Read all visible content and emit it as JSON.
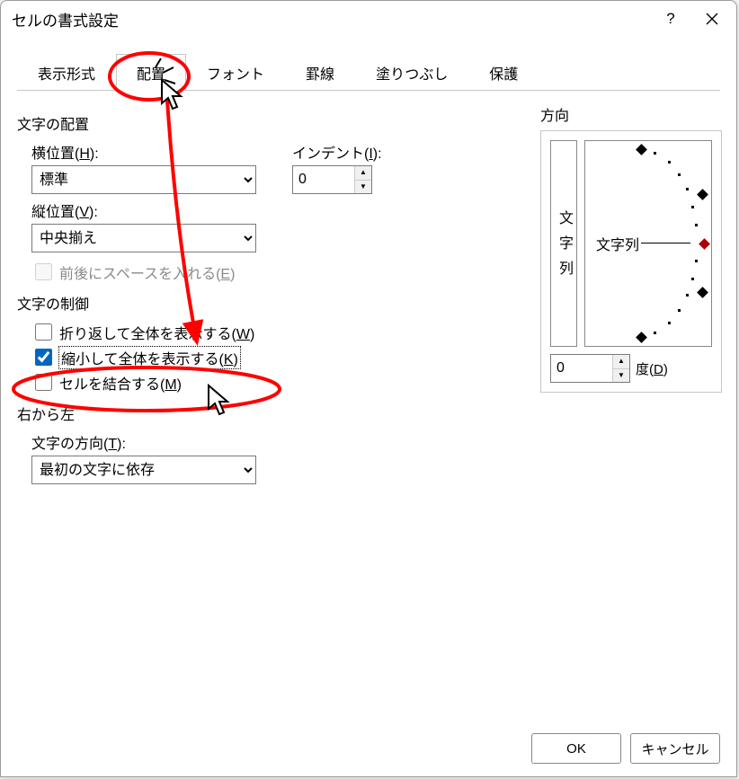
{
  "title": "セルの書式設定",
  "tabs": {
    "t0": "表示形式",
    "t1": "配置",
    "t2": "フォント",
    "t3": "罫線",
    "t4": "塗りつぶし",
    "t5": "保護"
  },
  "text_alignment": {
    "group": "文字の配置",
    "horizontal_label_pre": "横位置(",
    "horizontal_hotkey": "H",
    "horizontal_label_post": "):",
    "horizontal_value": "標準",
    "vertical_label_pre": "縦位置(",
    "vertical_hotkey": "V",
    "vertical_label_post": "):",
    "vertical_value": "中央揃え",
    "indent_label_pre": "インデント(",
    "indent_hotkey": "I",
    "indent_label_post": "):",
    "indent_value": "0",
    "space_pre": "前後にスペースを入れる(",
    "space_hotkey": "E",
    "space_post": ")"
  },
  "text_control": {
    "group": "文字の制御",
    "wrap_pre": "折り返して全体を表示する(",
    "wrap_hotkey": "W",
    "wrap_post": ")",
    "shrink_pre": "縮小して全体を表示する(",
    "shrink_hotkey": "K",
    "shrink_post": ")",
    "merge_pre": "セルを結合する(",
    "merge_hotkey": "M",
    "merge_post": ")"
  },
  "right_to_left": {
    "group": "右から左",
    "dir_label_pre": "文字の方向(",
    "dir_hotkey": "T",
    "dir_label_post": "):",
    "dir_value": "最初の文字に依存"
  },
  "orientation": {
    "group": "方向",
    "vertical_text": "文字列",
    "center_label": "文字列",
    "degree_value": "0",
    "degree_label_pre": "度(",
    "degree_hotkey": "D",
    "degree_label_post": ")"
  },
  "footer": {
    "ok": "OK",
    "cancel": "キャンセル"
  },
  "checkbox_state": {
    "space": false,
    "wrap": false,
    "shrink": true,
    "merge": false
  }
}
